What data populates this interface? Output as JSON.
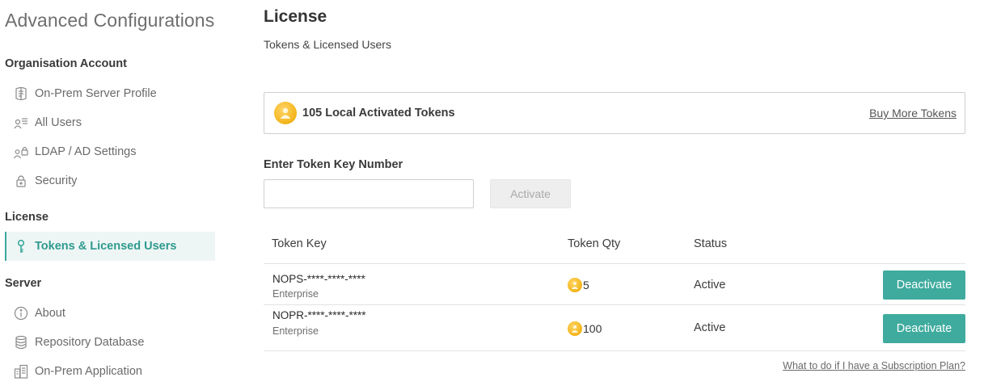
{
  "sidebar": {
    "title": "Advanced Configurations",
    "sections": [
      {
        "label": "Organisation Account",
        "items": [
          {
            "label": "On-Prem Server Profile",
            "icon": "server-profile-icon"
          },
          {
            "label": "All Users",
            "icon": "users-list-icon"
          },
          {
            "label": "LDAP / AD Settings",
            "icon": "ldap-lock-icon"
          },
          {
            "label": "Security",
            "icon": "lock-icon"
          }
        ]
      },
      {
        "label": "License",
        "items": [
          {
            "label": "Tokens & Licensed Users",
            "icon": "key-icon",
            "active": true
          }
        ]
      },
      {
        "label": "Server",
        "items": [
          {
            "label": "About",
            "icon": "info-icon"
          },
          {
            "label": "Repository Database",
            "icon": "database-icon"
          },
          {
            "label": "On-Prem Application",
            "icon": "application-icon"
          }
        ]
      }
    ]
  },
  "main": {
    "title": "License",
    "subtitle": "Tokens & Licensed Users",
    "tokens_card": {
      "label": "105 Local Activated Tokens",
      "buy_link": "Buy More Tokens"
    },
    "token_key_label": "Enter Token Key Number",
    "token_input": {
      "value": "",
      "placeholder": ""
    },
    "activate_label": "Activate",
    "table": {
      "headers": [
        "Token Key",
        "Token Qty",
        "Status"
      ],
      "rows": [
        {
          "key": "NOPS-****-****-****",
          "edition": "Enterprise",
          "qty": "5",
          "status": "Active",
          "action": "Deactivate"
        },
        {
          "key": "NOPR-****-****-****",
          "edition": "Enterprise",
          "qty": "100",
          "status": "Active",
          "action": "Deactivate"
        }
      ]
    },
    "help_link": "What to do if I have a Subscription Plan?"
  },
  "colors": {
    "accent": "#3fab9e",
    "active_bg": "#eef6f5",
    "coin": "#f4b41a"
  }
}
